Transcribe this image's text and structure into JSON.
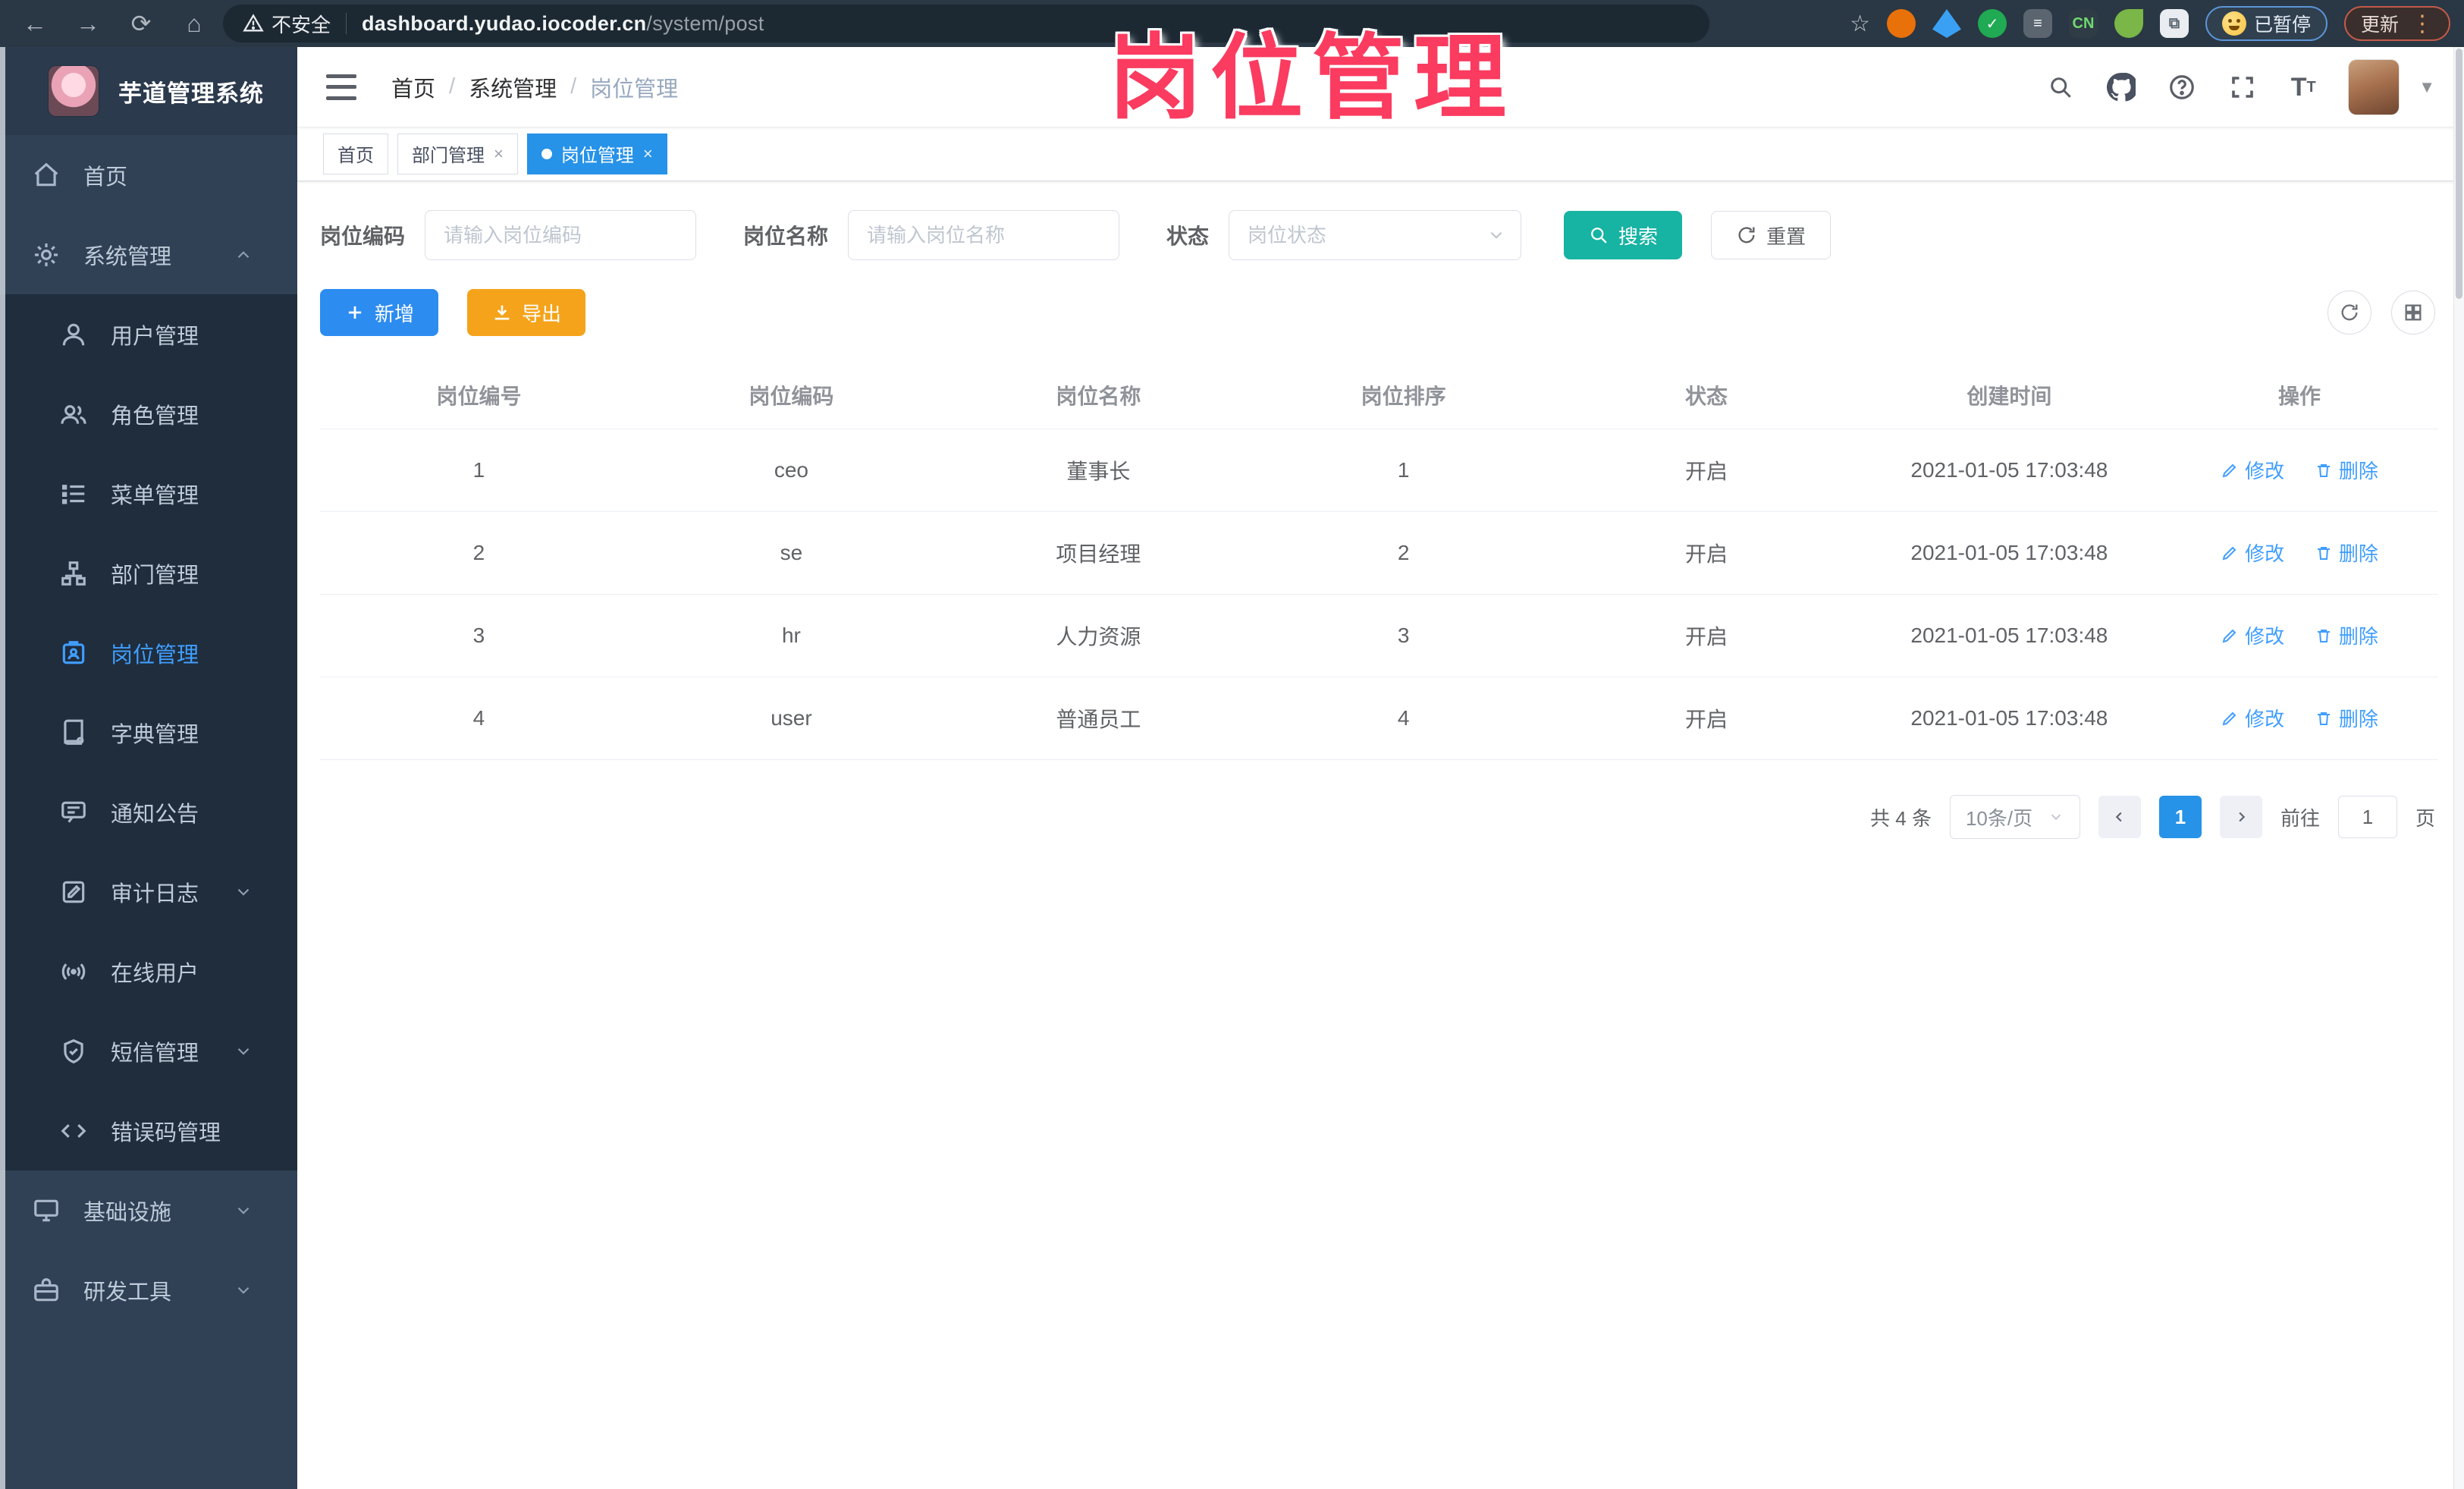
{
  "watermark_text": "岗位管理",
  "browser": {
    "security_label": "不安全",
    "url_host": "dashboard.yudao.iocoder.cn",
    "url_path": "/system/post",
    "paused_label": "已暂停",
    "update_label": "更新"
  },
  "sidebar": {
    "app_title": "芋道管理系统",
    "items": [
      {
        "label": "首页"
      },
      {
        "label": "系统管理"
      },
      {
        "label": "用户管理"
      },
      {
        "label": "角色管理"
      },
      {
        "label": "菜单管理"
      },
      {
        "label": "部门管理"
      },
      {
        "label": "岗位管理"
      },
      {
        "label": "字典管理"
      },
      {
        "label": "通知公告"
      },
      {
        "label": "审计日志"
      },
      {
        "label": "在线用户"
      },
      {
        "label": "短信管理"
      },
      {
        "label": "错误码管理"
      },
      {
        "label": "基础设施"
      },
      {
        "label": "研发工具"
      }
    ]
  },
  "navbar": {
    "breadcrumb": [
      "首页",
      "系统管理",
      "岗位管理"
    ]
  },
  "tags": [
    {
      "label": "首页"
    },
    {
      "label": "部门管理"
    },
    {
      "label": "岗位管理"
    }
  ],
  "filters": {
    "code_label": "岗位编码",
    "code_placeholder": "请输入岗位编码",
    "name_label": "岗位名称",
    "name_placeholder": "请输入岗位名称",
    "status_label": "状态",
    "status_placeholder": "岗位状态",
    "search_label": "搜索",
    "reset_label": "重置"
  },
  "toolbar": {
    "add_label": "新增",
    "export_label": "导出"
  },
  "table": {
    "columns": [
      "岗位编号",
      "岗位编码",
      "岗位名称",
      "岗位排序",
      "状态",
      "创建时间",
      "操作"
    ],
    "rows": [
      [
        "1",
        "ceo",
        "董事长",
        "1",
        "开启",
        "2021-01-05 17:03:48"
      ],
      [
        "2",
        "se",
        "项目经理",
        "2",
        "开启",
        "2021-01-05 17:03:48"
      ],
      [
        "3",
        "hr",
        "人力资源",
        "3",
        "开启",
        "2021-01-05 17:03:48"
      ],
      [
        "4",
        "user",
        "普通员工",
        "4",
        "开启",
        "2021-01-05 17:03:48"
      ]
    ],
    "edit_label": "修改",
    "delete_label": "删除"
  },
  "pagination": {
    "total_label": "共 4 条",
    "page_size_label": "10条/页",
    "page": "1",
    "goto_label": "前往",
    "goto_value": "1",
    "unit_label": "页"
  },
  "colors": {
    "primary_blue": "#2d8cf0",
    "active_link": "#409eff",
    "search_teal": "#17b3a3",
    "export_orange": "#f5a31b",
    "watermark_pink": "#fb3b5f",
    "sidebar_bg": "#304156",
    "submenu_bg": "#1f2d3d",
    "tag_active": "#2692e8"
  }
}
